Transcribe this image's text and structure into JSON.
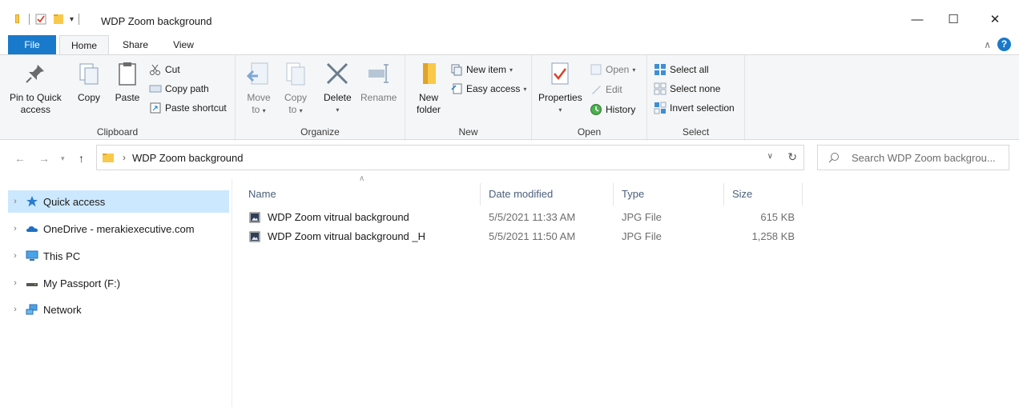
{
  "window": {
    "title": "WDP Zoom background",
    "minimize": "—",
    "maximize": "☐",
    "close": "✕"
  },
  "ribbon_tabs": [
    "File",
    "Home",
    "Share",
    "View"
  ],
  "ribbon": {
    "clipboard": {
      "label": "Clipboard",
      "pin_line1": "Pin to Quick",
      "pin_line2": "access",
      "copy": "Copy",
      "paste": "Paste",
      "cut": "Cut",
      "copy_path": "Copy path",
      "paste_shortcut": "Paste shortcut"
    },
    "organize": {
      "label": "Organize",
      "move_to": "Move",
      "move_to2": "to",
      "copy_to": "Copy",
      "copy_to2": "to",
      "delete": "Delete",
      "rename": "Rename"
    },
    "new": {
      "label": "New",
      "new_folder1": "New",
      "new_folder2": "folder",
      "new_item": "New item",
      "easy_access": "Easy access"
    },
    "open": {
      "label": "Open",
      "properties": "Properties",
      "open": "Open",
      "edit": "Edit",
      "history": "History"
    },
    "select": {
      "label": "Select",
      "select_all": "Select all",
      "select_none": "Select none",
      "invert": "Invert selection"
    }
  },
  "address": {
    "path": "WDP Zoom background",
    "search_placeholder": "Search WDP Zoom backgrou..."
  },
  "nav": [
    {
      "label": "Quick access",
      "icon": "star-icon"
    },
    {
      "label": "OneDrive - merakiexecutive.com",
      "icon": "cloud-icon"
    },
    {
      "label": "This PC",
      "icon": "monitor-icon"
    },
    {
      "label": "My Passport (F:)",
      "icon": "drive-icon"
    },
    {
      "label": "Network",
      "icon": "network-icon"
    }
  ],
  "columns": [
    "Name",
    "Date modified",
    "Type",
    "Size"
  ],
  "files": [
    {
      "name": "WDP Zoom vitrual background",
      "date": "5/5/2021 11:33 AM",
      "type": "JPG File",
      "size": "615 KB"
    },
    {
      "name": "WDP Zoom vitrual background _H",
      "date": "5/5/2021 11:50 AM",
      "type": "JPG File",
      "size": "1,258 KB"
    }
  ],
  "colors": {
    "accent": "#1979ca",
    "selected": "#cce8ff",
    "ribbon_bg": "#f5f6f7",
    "folder": "#f8c94a"
  }
}
